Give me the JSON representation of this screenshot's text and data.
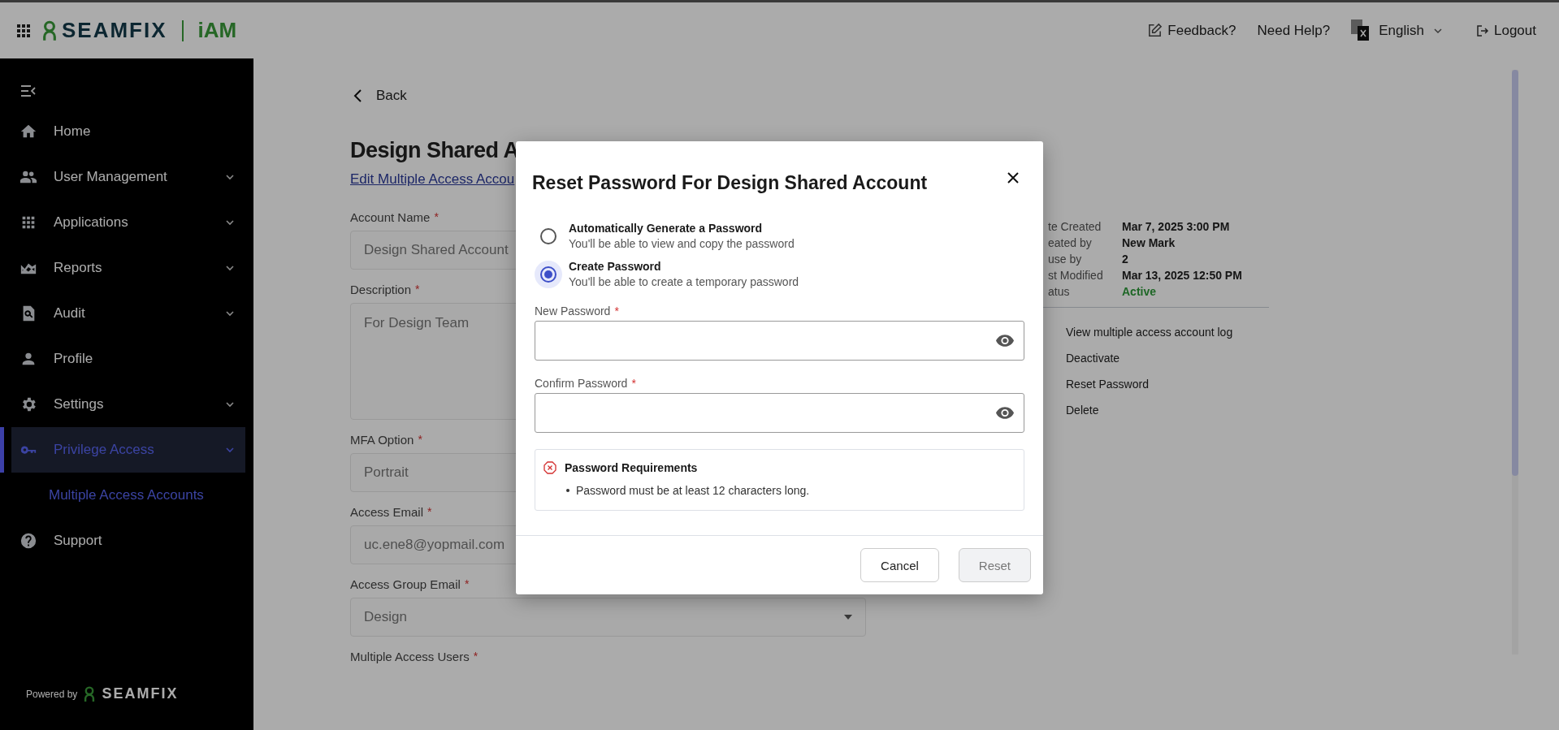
{
  "header": {
    "brand": "SEAMFIX",
    "product": "iAM",
    "feedback": "Feedback?",
    "help": "Need Help?",
    "language": "English",
    "logout": "Logout"
  },
  "sidebar": {
    "items": [
      {
        "label": "Home",
        "expandable": false,
        "selected": false
      },
      {
        "label": "User Management",
        "expandable": true,
        "selected": false
      },
      {
        "label": "Applications",
        "expandable": true,
        "selected": false
      },
      {
        "label": "Reports",
        "expandable": true,
        "selected": false
      },
      {
        "label": "Audit",
        "expandable": true,
        "selected": false
      },
      {
        "label": "Profile",
        "expandable": false,
        "selected": false
      },
      {
        "label": "Settings",
        "expandable": true,
        "selected": false
      },
      {
        "label": "Privilege Access",
        "expandable": true,
        "selected": true,
        "children": [
          {
            "label": "Multiple Access Accounts",
            "selected": true
          }
        ]
      },
      {
        "label": "Support",
        "expandable": false,
        "selected": false
      }
    ],
    "footer": {
      "powered_by": "Powered by",
      "brand": "SEAMFIX"
    }
  },
  "page": {
    "back": "Back",
    "title": "Design Shared A",
    "edit_link": "Edit Multiple Access Accou",
    "fields": [
      {
        "label": "Account Name",
        "required_mark": "*",
        "kind": "input",
        "value": "Design Shared Account"
      },
      {
        "label": "Description",
        "required_mark": "*",
        "kind": "textarea",
        "value": "For Design Team"
      },
      {
        "label": "MFA Option",
        "required_mark": "*",
        "kind": "input",
        "value": "Portrait"
      },
      {
        "label": "Access Email",
        "required_mark": "*",
        "kind": "input",
        "value": "uc.ene8@yopmail.com"
      },
      {
        "label": "Access Group Email",
        "required_mark": "*",
        "kind": "select",
        "value": "Design"
      },
      {
        "label": "Multiple Access Users",
        "required_mark": "*",
        "kind": "label"
      }
    ],
    "details": [
      {
        "label": "te Created",
        "value": "Mar 7, 2025 3:00 PM",
        "kind": "text"
      },
      {
        "label": "eated by",
        "value": "New Mark",
        "kind": "text"
      },
      {
        "label": "use by",
        "value": "2",
        "kind": "text"
      },
      {
        "label": "st Modified",
        "value": "Mar 13, 2025 12:50 PM",
        "kind": "text"
      },
      {
        "label": "atus",
        "value": "Active",
        "kind": "status"
      }
    ],
    "actions": [
      "View multiple access account log",
      "Deactivate",
      "Reset Password",
      "Delete"
    ]
  },
  "modal": {
    "title": "Reset Password For Design Shared Account",
    "options": [
      {
        "title": "Automatically Generate a Password",
        "subtitle": "You'll be able to view and copy the password",
        "selected": false
      },
      {
        "title": "Create Password",
        "subtitle": "You'll be able to create a temporary password",
        "selected": true
      }
    ],
    "fields": [
      {
        "label": "New Password",
        "required_mark": "*"
      },
      {
        "label": "Confirm Password",
        "required_mark": "*"
      }
    ],
    "requirements": {
      "title": "Password Requirements",
      "met": false,
      "items": [
        "Password must be at least 12 characters long."
      ]
    },
    "cancel": "Cancel",
    "reset": {
      "label": "Reset",
      "disabled": true
    }
  }
}
